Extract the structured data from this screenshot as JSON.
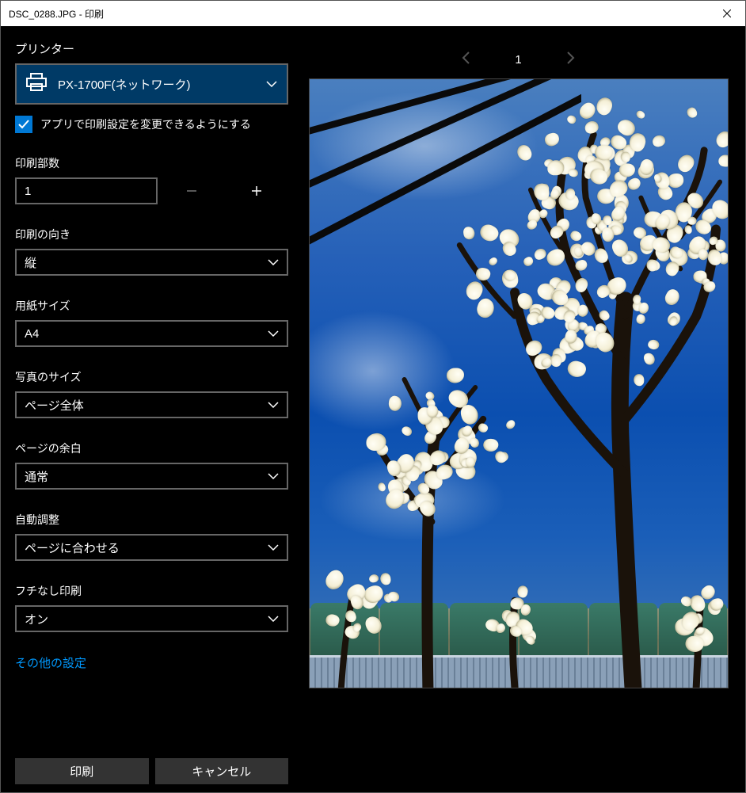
{
  "title": "DSC_0288.JPG - 印刷",
  "settings": {
    "printer_label": "プリンター",
    "printer_name": "PX-1700F(ネットワーク)",
    "allow_app_change": "アプリで印刷設定を変更できるようにする",
    "copies_label": "印刷部数",
    "copies_value": "1",
    "orientation_label": "印刷の向き",
    "orientation_value": "縦",
    "paper_label": "用紙サイズ",
    "paper_value": "A4",
    "photo_label": "写真のサイズ",
    "photo_value": "ページ全体",
    "margin_label": "ページの余白",
    "margin_value": "通常",
    "fit_label": "自動調整",
    "fit_value": "ページに合わせる",
    "borderless_label": "フチなし印刷",
    "borderless_value": "オン",
    "more_link": "その他の設定"
  },
  "buttons": {
    "print": "印刷",
    "cancel": "キャンセル"
  },
  "pager": {
    "current": "1"
  }
}
